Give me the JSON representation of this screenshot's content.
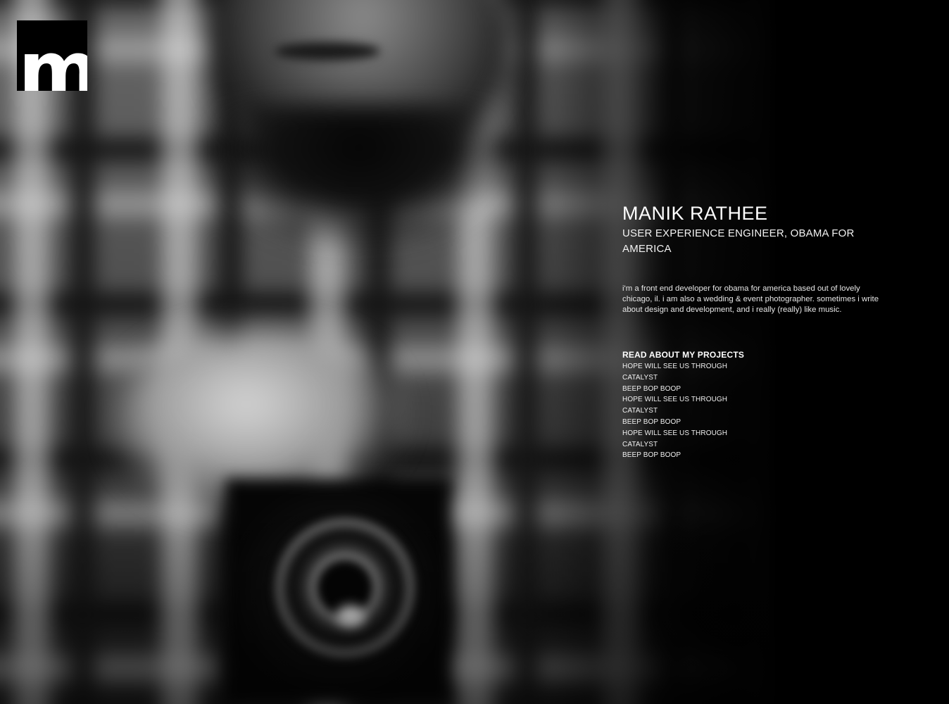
{
  "logo": {
    "glyph": "m",
    "icon": "m-logo-icon"
  },
  "profile": {
    "name": "MANIK RATHEE",
    "role": "USER EXPERIENCE ENGINEER, OBAMA FOR AMERICA",
    "bio": "i'm a front end developer for obama for america based out of lovely chicago, il. i am also a wedding & event photographer. sometimes i write about design and development, and i really (really) like music."
  },
  "projects": {
    "heading": "READ ABOUT MY PROJECTS",
    "items": [
      {
        "label": "HOPE WILL SEE US THROUGH"
      },
      {
        "label": "CATALYST"
      },
      {
        "label": "BEEP BOP BOOP"
      },
      {
        "label": "HOPE WILL SEE US THROUGH"
      },
      {
        "label": "CATALYST"
      },
      {
        "label": "BEEP BOP BOOP"
      },
      {
        "label": "HOPE WILL SEE US THROUGH"
      },
      {
        "label": "CATALYST"
      },
      {
        "label": "BEEP BOP BOOP"
      }
    ]
  },
  "colors": {
    "background": "#000000",
    "text": "#ffffff"
  }
}
